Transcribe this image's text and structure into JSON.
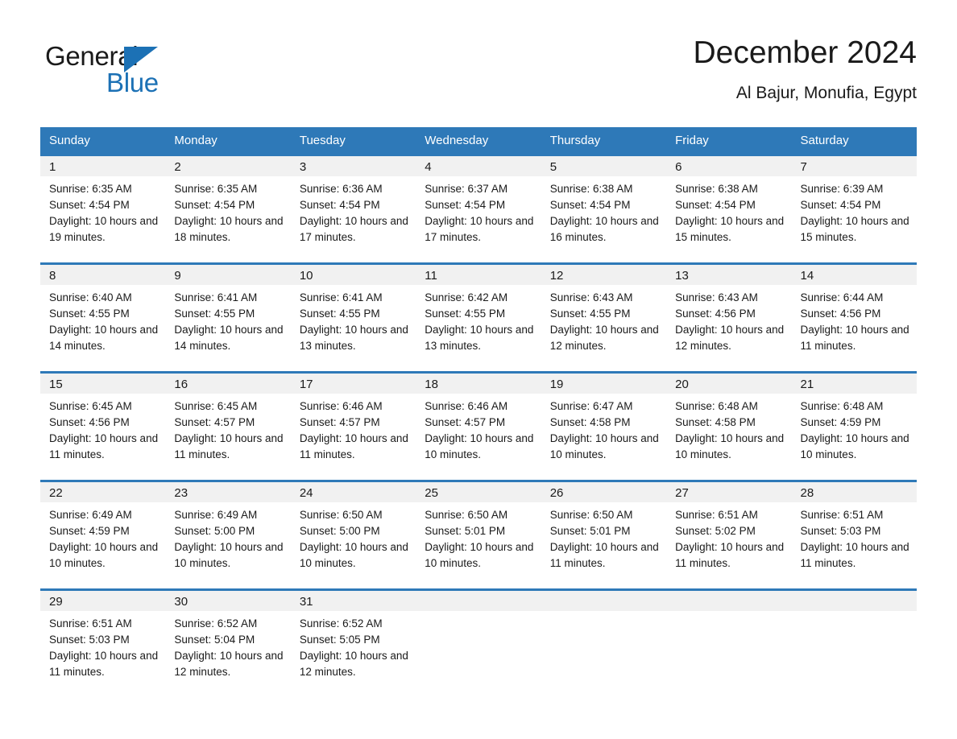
{
  "brand": {
    "name_part1": "General",
    "name_part2": "Blue",
    "accent_color": "#1c71b5"
  },
  "header": {
    "title": "December 2024",
    "location": "Al Bajur, Monufia, Egypt"
  },
  "theme": {
    "header_blue": "#2e79b8",
    "day_band_gray": "#f1f1f1",
    "text_color": "#1a1a1a"
  },
  "weekday_headers": [
    "Sunday",
    "Monday",
    "Tuesday",
    "Wednesday",
    "Thursday",
    "Friday",
    "Saturday"
  ],
  "weeks": [
    [
      {
        "day": "1",
        "sunrise": "Sunrise: 6:35 AM",
        "sunset": "Sunset: 4:54 PM",
        "daylight": "Daylight: 10 hours and 19 minutes."
      },
      {
        "day": "2",
        "sunrise": "Sunrise: 6:35 AM",
        "sunset": "Sunset: 4:54 PM",
        "daylight": "Daylight: 10 hours and 18 minutes."
      },
      {
        "day": "3",
        "sunrise": "Sunrise: 6:36 AM",
        "sunset": "Sunset: 4:54 PM",
        "daylight": "Daylight: 10 hours and 17 minutes."
      },
      {
        "day": "4",
        "sunrise": "Sunrise: 6:37 AM",
        "sunset": "Sunset: 4:54 PM",
        "daylight": "Daylight: 10 hours and 17 minutes."
      },
      {
        "day": "5",
        "sunrise": "Sunrise: 6:38 AM",
        "sunset": "Sunset: 4:54 PM",
        "daylight": "Daylight: 10 hours and 16 minutes."
      },
      {
        "day": "6",
        "sunrise": "Sunrise: 6:38 AM",
        "sunset": "Sunset: 4:54 PM",
        "daylight": "Daylight: 10 hours and 15 minutes."
      },
      {
        "day": "7",
        "sunrise": "Sunrise: 6:39 AM",
        "sunset": "Sunset: 4:54 PM",
        "daylight": "Daylight: 10 hours and 15 minutes."
      }
    ],
    [
      {
        "day": "8",
        "sunrise": "Sunrise: 6:40 AM",
        "sunset": "Sunset: 4:55 PM",
        "daylight": "Daylight: 10 hours and 14 minutes."
      },
      {
        "day": "9",
        "sunrise": "Sunrise: 6:41 AM",
        "sunset": "Sunset: 4:55 PM",
        "daylight": "Daylight: 10 hours and 14 minutes."
      },
      {
        "day": "10",
        "sunrise": "Sunrise: 6:41 AM",
        "sunset": "Sunset: 4:55 PM",
        "daylight": "Daylight: 10 hours and 13 minutes."
      },
      {
        "day": "11",
        "sunrise": "Sunrise: 6:42 AM",
        "sunset": "Sunset: 4:55 PM",
        "daylight": "Daylight: 10 hours and 13 minutes."
      },
      {
        "day": "12",
        "sunrise": "Sunrise: 6:43 AM",
        "sunset": "Sunset: 4:55 PM",
        "daylight": "Daylight: 10 hours and 12 minutes."
      },
      {
        "day": "13",
        "sunrise": "Sunrise: 6:43 AM",
        "sunset": "Sunset: 4:56 PM",
        "daylight": "Daylight: 10 hours and 12 minutes."
      },
      {
        "day": "14",
        "sunrise": "Sunrise: 6:44 AM",
        "sunset": "Sunset: 4:56 PM",
        "daylight": "Daylight: 10 hours and 11 minutes."
      }
    ],
    [
      {
        "day": "15",
        "sunrise": "Sunrise: 6:45 AM",
        "sunset": "Sunset: 4:56 PM",
        "daylight": "Daylight: 10 hours and 11 minutes."
      },
      {
        "day": "16",
        "sunrise": "Sunrise: 6:45 AM",
        "sunset": "Sunset: 4:57 PM",
        "daylight": "Daylight: 10 hours and 11 minutes."
      },
      {
        "day": "17",
        "sunrise": "Sunrise: 6:46 AM",
        "sunset": "Sunset: 4:57 PM",
        "daylight": "Daylight: 10 hours and 11 minutes."
      },
      {
        "day": "18",
        "sunrise": "Sunrise: 6:46 AM",
        "sunset": "Sunset: 4:57 PM",
        "daylight": "Daylight: 10 hours and 10 minutes."
      },
      {
        "day": "19",
        "sunrise": "Sunrise: 6:47 AM",
        "sunset": "Sunset: 4:58 PM",
        "daylight": "Daylight: 10 hours and 10 minutes."
      },
      {
        "day": "20",
        "sunrise": "Sunrise: 6:48 AM",
        "sunset": "Sunset: 4:58 PM",
        "daylight": "Daylight: 10 hours and 10 minutes."
      },
      {
        "day": "21",
        "sunrise": "Sunrise: 6:48 AM",
        "sunset": "Sunset: 4:59 PM",
        "daylight": "Daylight: 10 hours and 10 minutes."
      }
    ],
    [
      {
        "day": "22",
        "sunrise": "Sunrise: 6:49 AM",
        "sunset": "Sunset: 4:59 PM",
        "daylight": "Daylight: 10 hours and 10 minutes."
      },
      {
        "day": "23",
        "sunrise": "Sunrise: 6:49 AM",
        "sunset": "Sunset: 5:00 PM",
        "daylight": "Daylight: 10 hours and 10 minutes."
      },
      {
        "day": "24",
        "sunrise": "Sunrise: 6:50 AM",
        "sunset": "Sunset: 5:00 PM",
        "daylight": "Daylight: 10 hours and 10 minutes."
      },
      {
        "day": "25",
        "sunrise": "Sunrise: 6:50 AM",
        "sunset": "Sunset: 5:01 PM",
        "daylight": "Daylight: 10 hours and 10 minutes."
      },
      {
        "day": "26",
        "sunrise": "Sunrise: 6:50 AM",
        "sunset": "Sunset: 5:01 PM",
        "daylight": "Daylight: 10 hours and 11 minutes."
      },
      {
        "day": "27",
        "sunrise": "Sunrise: 6:51 AM",
        "sunset": "Sunset: 5:02 PM",
        "daylight": "Daylight: 10 hours and 11 minutes."
      },
      {
        "day": "28",
        "sunrise": "Sunrise: 6:51 AM",
        "sunset": "Sunset: 5:03 PM",
        "daylight": "Daylight: 10 hours and 11 minutes."
      }
    ],
    [
      {
        "day": "29",
        "sunrise": "Sunrise: 6:51 AM",
        "sunset": "Sunset: 5:03 PM",
        "daylight": "Daylight: 10 hours and 11 minutes."
      },
      {
        "day": "30",
        "sunrise": "Sunrise: 6:52 AM",
        "sunset": "Sunset: 5:04 PM",
        "daylight": "Daylight: 10 hours and 12 minutes."
      },
      {
        "day": "31",
        "sunrise": "Sunrise: 6:52 AM",
        "sunset": "Sunset: 5:05 PM",
        "daylight": "Daylight: 10 hours and 12 minutes."
      },
      {
        "day": "",
        "sunrise": "",
        "sunset": "",
        "daylight": ""
      },
      {
        "day": "",
        "sunrise": "",
        "sunset": "",
        "daylight": ""
      },
      {
        "day": "",
        "sunrise": "",
        "sunset": "",
        "daylight": ""
      },
      {
        "day": "",
        "sunrise": "",
        "sunset": "",
        "daylight": ""
      }
    ]
  ]
}
